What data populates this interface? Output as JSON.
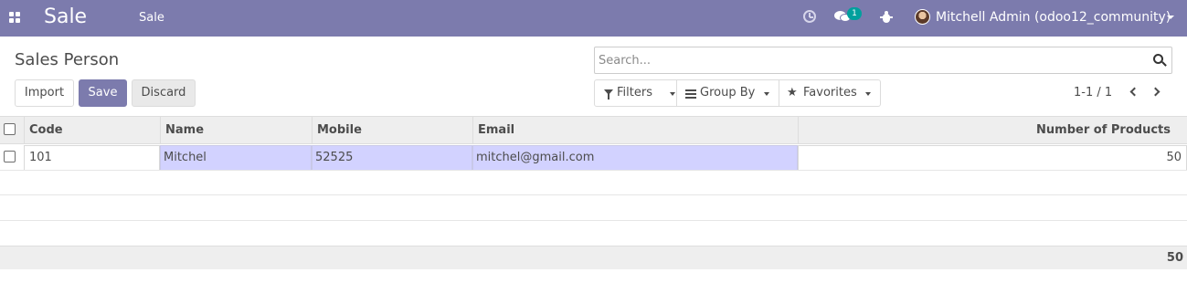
{
  "navbar": {
    "brand": "Sale",
    "menu_item": "Sale",
    "chat_badge": "1",
    "user_name": "Mitchell Admin (odoo12_community)",
    "bg_color": "#7c7bad",
    "icons": [
      "apps-grid-icon",
      "clock-icon",
      "chat-icon",
      "bug-icon",
      "avatar",
      "caret-down-icon"
    ]
  },
  "control_panel": {
    "title": "Sales Person",
    "buttons": {
      "import": "Import",
      "save": "Save",
      "discard": "Discard"
    },
    "search": {
      "placeholder": "Search..."
    },
    "filters": {
      "filters": "Filters",
      "group_by": "Group By",
      "favorites": "Favorites"
    },
    "pager": "1-1 / 1"
  },
  "table": {
    "headers": {
      "code": "Code",
      "name": "Name",
      "mobile": "Mobile",
      "email": "Email",
      "num_products": "Number of Products"
    },
    "rows": [
      {
        "code": "101",
        "name": "Mitchel",
        "mobile": "52525",
        "email": "mitchel@gmail.com",
        "num_products": "50"
      }
    ],
    "footer_total": "50",
    "required_field_color": "#d2d2ff"
  }
}
